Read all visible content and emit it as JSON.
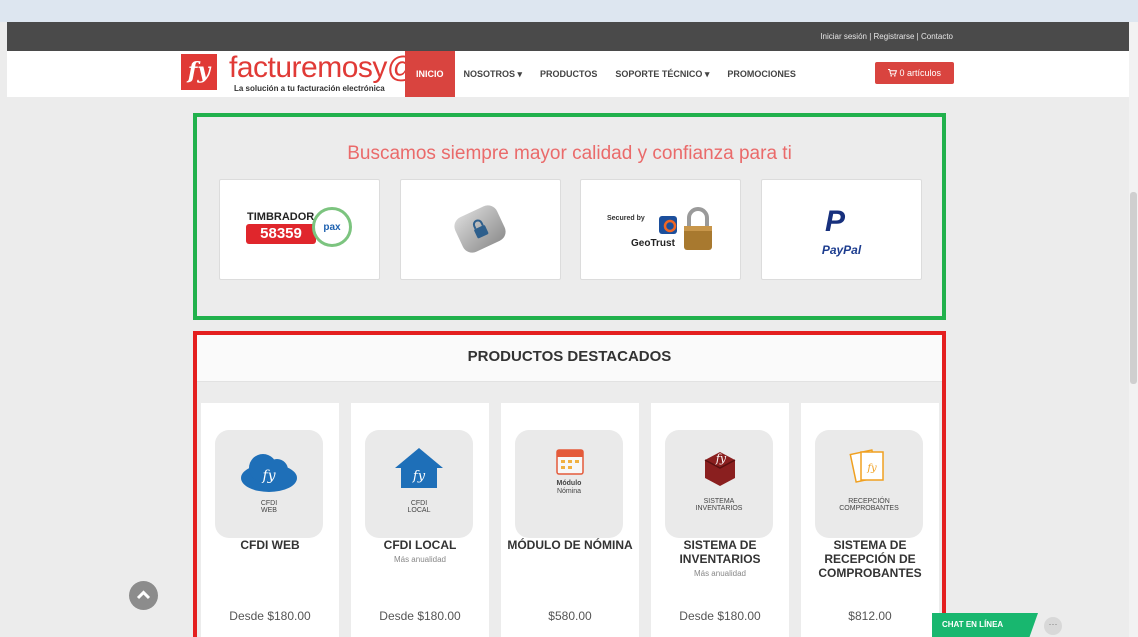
{
  "topbar": {
    "login": "Iniciar sesión",
    "register": "Registrarse",
    "contact": "Contacto",
    "separator": "|"
  },
  "logo": {
    "mark": "fy",
    "name": "facturemosy@",
    "tagline": "La solución a tu facturación electrónica"
  },
  "nav": {
    "items": [
      {
        "label": "INICIO",
        "active": true
      },
      {
        "label": "NOSOTROS ▾"
      },
      {
        "label": "PRODUCTOS"
      },
      {
        "label": "SOPORTE TÉCNICO ▾"
      },
      {
        "label": "PROMOCIONES"
      }
    ]
  },
  "cart": {
    "label": "0 artículos",
    "icon": "cart-icon"
  },
  "trust": {
    "title": "Buscamos siempre mayor calidad y confianza para ti",
    "badges": [
      {
        "name": "timbrador",
        "line1": "TIMBRADOR",
        "number": "58359",
        "seal": "pax"
      },
      {
        "name": "ssl-lock",
        "icon": "lock-icon"
      },
      {
        "name": "geotrust",
        "secured": "Secured by",
        "brand": "GeoTrust"
      },
      {
        "name": "paypal",
        "brand": "PayPal"
      }
    ]
  },
  "products": {
    "title": "PRODUCTOS DESTACADOS",
    "items": [
      {
        "title": "CFDI WEB",
        "thumb_label": "CFDI\nWEB",
        "sub": "",
        "price": "Desde $180.00",
        "icon": "cloud-icon",
        "accent": "#1e6fb8"
      },
      {
        "title": "CFDI LOCAL",
        "thumb_label": "CFDI\nLOCAL",
        "sub": "Más anualidad",
        "price": "Desde $180.00",
        "icon": "house-icon",
        "accent": "#1e6fb8"
      },
      {
        "title": "MÓDULO DE NÓMINA",
        "thumb_label": "Módulo\nNómina",
        "sub": "",
        "price": "$580.00",
        "icon": "calendar-icon",
        "accent": "#e45a3a"
      },
      {
        "title": "SISTEMA DE INVENTARIOS",
        "thumb_label": "SISTEMA\nINVENTARIOS",
        "sub": "Más anualidad",
        "price": "Desde $180.00",
        "icon": "box-icon",
        "accent": "#8a1f1f"
      },
      {
        "title": "SISTEMA DE RECEPCIÓN DE COMPROBANTES",
        "thumb_label": "RECEPCIÓN\nCOMPROBANTES",
        "sub": "",
        "price": "$812.00",
        "icon": "documents-icon",
        "accent": "#f0a020"
      }
    ]
  },
  "chat": {
    "label": "CHAT EN LÍNEA",
    "bubble": "···"
  },
  "colors": {
    "brand_red": "#d9443f",
    "trust_border": "#21b14c",
    "products_border": "#e41f1f",
    "chat_green": "#18b76f"
  }
}
